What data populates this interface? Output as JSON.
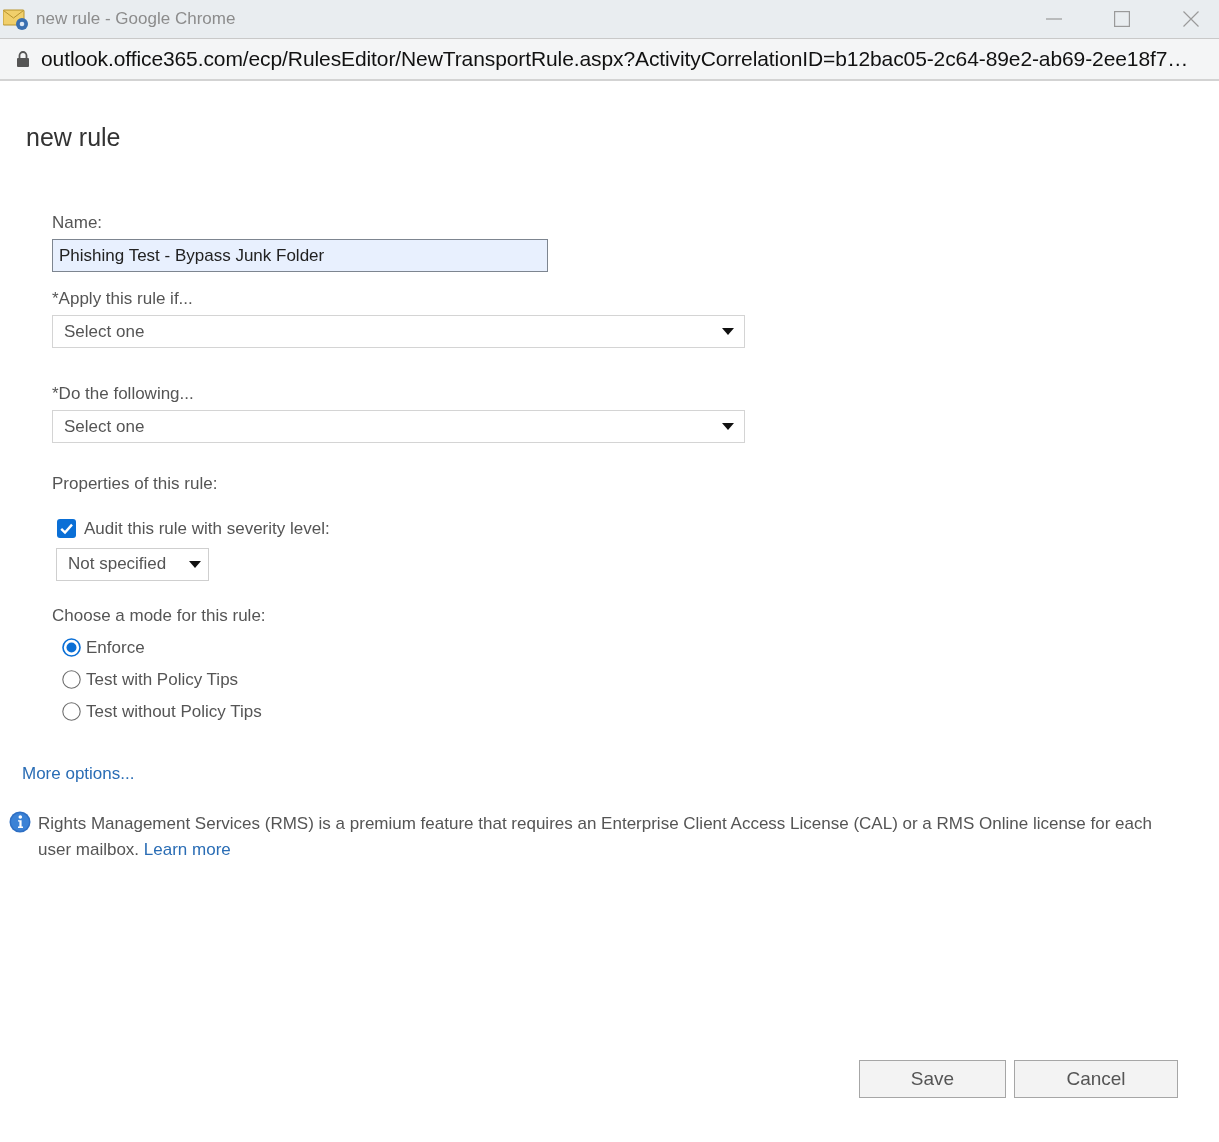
{
  "window": {
    "title": "new rule - Google Chrome"
  },
  "address_bar": {
    "url": "outlook.office365.com/ecp/RulesEditor/NewTransportRule.aspx?ActivityCorrelationID=b12bac05-2c64-89e2-ab69-2ee18f7…"
  },
  "dialog": {
    "title": "new rule"
  },
  "name_field": {
    "label": "Name:",
    "value": "Phishing Test - Bypass Junk Folder"
  },
  "conditions": [
    {
      "label": "*Apply this rule if...",
      "value": "Select one"
    },
    {
      "label": "*Do the following...",
      "value": "Select one"
    }
  ],
  "properties": {
    "heading": "Properties of this rule:",
    "audit": {
      "label": "Audit this rule with severity level:",
      "checked": true
    },
    "severity": {
      "value": "Not specified"
    }
  },
  "mode": {
    "heading": "Choose a mode for this rule:",
    "options": [
      {
        "label": "Enforce",
        "selected": true
      },
      {
        "label": "Test with Policy Tips",
        "selected": false
      },
      {
        "label": "Test without Policy Tips",
        "selected": false
      }
    ]
  },
  "more_options": "More options...",
  "notice": {
    "text": "Rights Management Services (RMS) is a premium feature that requires an Enterprise Client Access License (CAL) or a RMS Online license for each user mailbox.",
    "link": "Learn more"
  },
  "buttons": [
    "Save",
    "Cancel"
  ]
}
